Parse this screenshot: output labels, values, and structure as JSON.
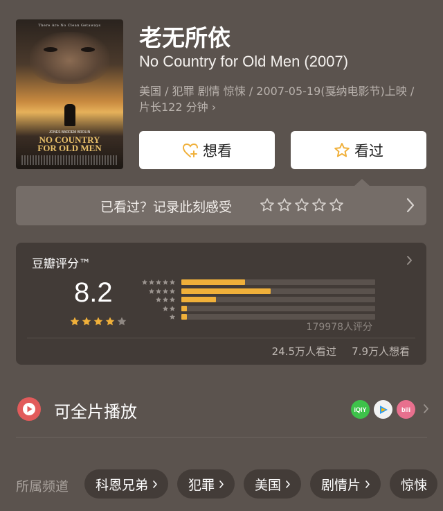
{
  "movie": {
    "poster_tagline": "There Are No Clean Getaways",
    "poster_cast": "JONES   BARDEM   BROLIN",
    "poster_title_line1": "NO COUNTRY",
    "poster_title_line2": "FOR OLD MEN",
    "title_cn": "老无所依",
    "title_en": "No Country for Old Men (2007)",
    "meta": "美国 / 犯罪 剧情 惊悚 / 2007-05-19(戛纳电影节)上映 / 片长122 分钟 ›"
  },
  "actions": {
    "want_label": "想看",
    "seen_label": "看过"
  },
  "record": {
    "prompt": "已看过？记录此刻感受"
  },
  "rating": {
    "label": "豆瓣评分™",
    "score": "8.2",
    "stars": 4,
    "distribution": [
      0.33,
      0.46,
      0.18,
      0.03,
      0.03
    ],
    "count": "179978人评分",
    "seen": "24.5万人看过",
    "wish": "7.9万人想看"
  },
  "playable": {
    "label": "可全片播放",
    "platforms": [
      "iQIYI",
      "Tencent Video",
      "bilibili"
    ]
  },
  "channels": {
    "label": "所属频道",
    "items": [
      "科恩兄弟",
      "犯罪",
      "美国",
      "剧情片",
      "惊悚"
    ]
  },
  "colors": {
    "background": "#5b534e",
    "accent_star": "#f0b03a",
    "play_red": "#e25b5b"
  }
}
